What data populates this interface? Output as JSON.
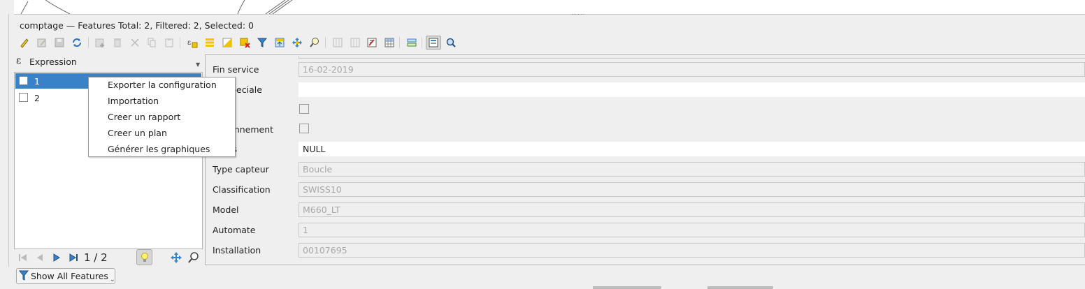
{
  "window": {
    "title": "comptage — Features Total: 2, Filtered: 2, Selected: 0"
  },
  "toolbar": {
    "icons": [
      "pencil-icon",
      "multi-edit-icon",
      "save-icon",
      "reload-icon",
      "add-feature-icon",
      "delete-icon",
      "cut-icon",
      "copy-icon",
      "paste-icon",
      "expression-select-icon",
      "select-all-icon",
      "invert-selection-icon",
      "deselect-icon",
      "filter-icon",
      "move-to-top-icon",
      "pan-to-selection-icon",
      "zoom-to-selection-icon",
      "new-field-icon",
      "delete-field-icon",
      "field-calculator-icon",
      "conditional-format-icon",
      "actions-icon",
      "form-view-icon",
      "table-view-icon"
    ]
  },
  "left_panel": {
    "expression_label": "Expression",
    "features": [
      {
        "label": "1",
        "selected": true
      },
      {
        "label": "2",
        "selected": false
      }
    ],
    "pager_text": "1 / 2"
  },
  "context_menu": {
    "items": [
      "Exporter la configuration",
      "Importation",
      "Creer un rapport",
      "Creer un plan",
      "Générer les graphiques"
    ]
  },
  "form": {
    "fields": {
      "fin_service": {
        "label": "Fin service",
        "value": "16-02-2019"
      },
      "code_speciale": {
        "label": "de speciale",
        "value": ""
      },
      "field_e": {
        "label": "e"
      },
      "fonctionnement": {
        "label": "nctionnement"
      },
      "remarques": {
        "label": "rques",
        "value": "NULL"
      },
      "type_capteur": {
        "label": "Type capteur",
        "value": "Boucle"
      },
      "classification": {
        "label": "Classification",
        "value": "SWISS10"
      },
      "model": {
        "label": "Model",
        "value": "M660_LT"
      },
      "automate": {
        "label": "Automate",
        "value": "1"
      },
      "installation": {
        "label": "Installation",
        "value": "00107695"
      }
    }
  },
  "footer": {
    "filter_button_label": "Show All Features"
  },
  "colors": {
    "selection": "#3a82c8",
    "background": "#efefef"
  }
}
